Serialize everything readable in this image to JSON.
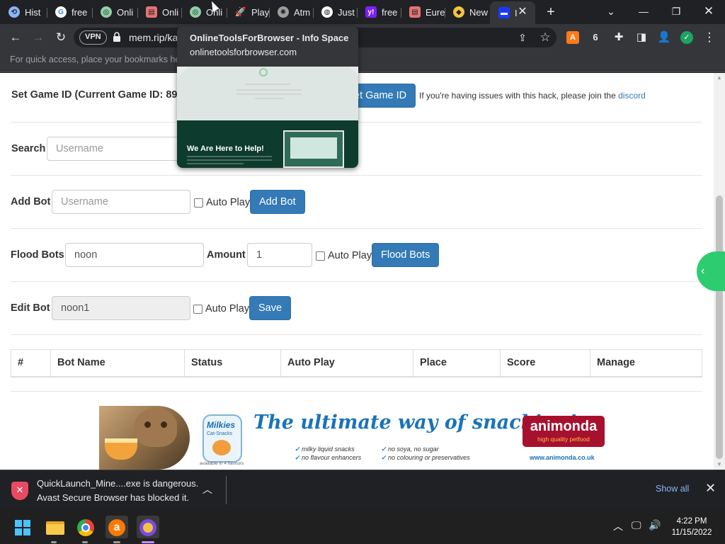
{
  "tabs": [
    {
      "label": "Hist",
      "icon": "history-icon",
      "color": "#8ab4f8"
    },
    {
      "label": "free",
      "icon": "google-icon",
      "color": "#ffffff"
    },
    {
      "label": "Onli",
      "icon": "onlinetools-icon",
      "color": "#8fd0a8"
    },
    {
      "label": "Onli",
      "icon": "store-icon",
      "color": "#e57373"
    },
    {
      "label": "Onli",
      "icon": "onlinetools-icon",
      "color": "#8fd0a8"
    },
    {
      "label": "Play",
      "icon": "rocket-icon",
      "color": "#b0b0b0"
    },
    {
      "label": "Atm",
      "icon": "atmosphere-icon",
      "color": "#9e9e9e"
    },
    {
      "label": "Just",
      "icon": "globe-icon",
      "color": "#ffffff"
    },
    {
      "label": "free",
      "icon": "yahoo-icon",
      "color": "#7e1fff"
    },
    {
      "label": "Eure",
      "icon": "store-icon",
      "color": "#e57373"
    },
    {
      "label": "New",
      "icon": "avast-browser-icon",
      "color": "#f6c243"
    },
    {
      "label": "I",
      "icon": "site-icon",
      "color": "#1a3bff"
    }
  ],
  "toolbar": {
    "vpn_label": "VPN",
    "url": "mem.rip/ka"
  },
  "bookmarks_hint": "For quick access, place your bookmarks here",
  "hovercard": {
    "title": "OnlineToolsForBrowser - Info Space",
    "url": "onlinetoolsforbrowser.com",
    "preview_heading": "We Are Here to Help!"
  },
  "form": {
    "game_id_label": "Set Game ID (Current Game ID: 894",
    "set_game_id_button": "et Game ID",
    "issue_note": "If you're having issues with this hack, please join the",
    "discord_link": "discord",
    "search_label": "Search",
    "search_placeholder": "Username",
    "add_bot_label": "Add Bot",
    "add_bot_placeholder": "Username",
    "auto_play": "Auto Play",
    "add_bot_button": "Add Bot",
    "flood_label": "Flood Bots",
    "flood_name": "noon",
    "amount_label": "Amount",
    "amount_value": "1",
    "flood_button": "Flood Bots",
    "edit_label": "Edit Bot",
    "edit_value": "noon1",
    "save_button": "Save"
  },
  "table": {
    "headers": [
      "#",
      "Bot Name",
      "Status",
      "Auto Play",
      "Place",
      "Score",
      "Manage"
    ]
  },
  "ad": {
    "product": "Milkies",
    "product_sub": "Cat-Snacks",
    "available": "available in 4 flavours",
    "slogan": "The ultimate way of snacking!",
    "features": [
      "milky liquid snacks",
      "no soya, no sugar",
      "no flavour enhancers",
      "no colouring or preservatives"
    ],
    "brand": "animonda",
    "brand_tag": "high quality petfood",
    "site": "www.animonda.co.uk"
  },
  "download": {
    "line1": "QuickLaunch_Mine....exe is dangerous.",
    "line2": "Avast Secure Browser has blocked it.",
    "show_all": "Show all"
  },
  "clock": {
    "time": "4:22 PM",
    "date": "11/15/2022"
  },
  "colors": {
    "accent_button": "#337ab7",
    "danger": "#e94a63",
    "link": "#8ab4f8",
    "side_tab": "#2ecc71"
  }
}
